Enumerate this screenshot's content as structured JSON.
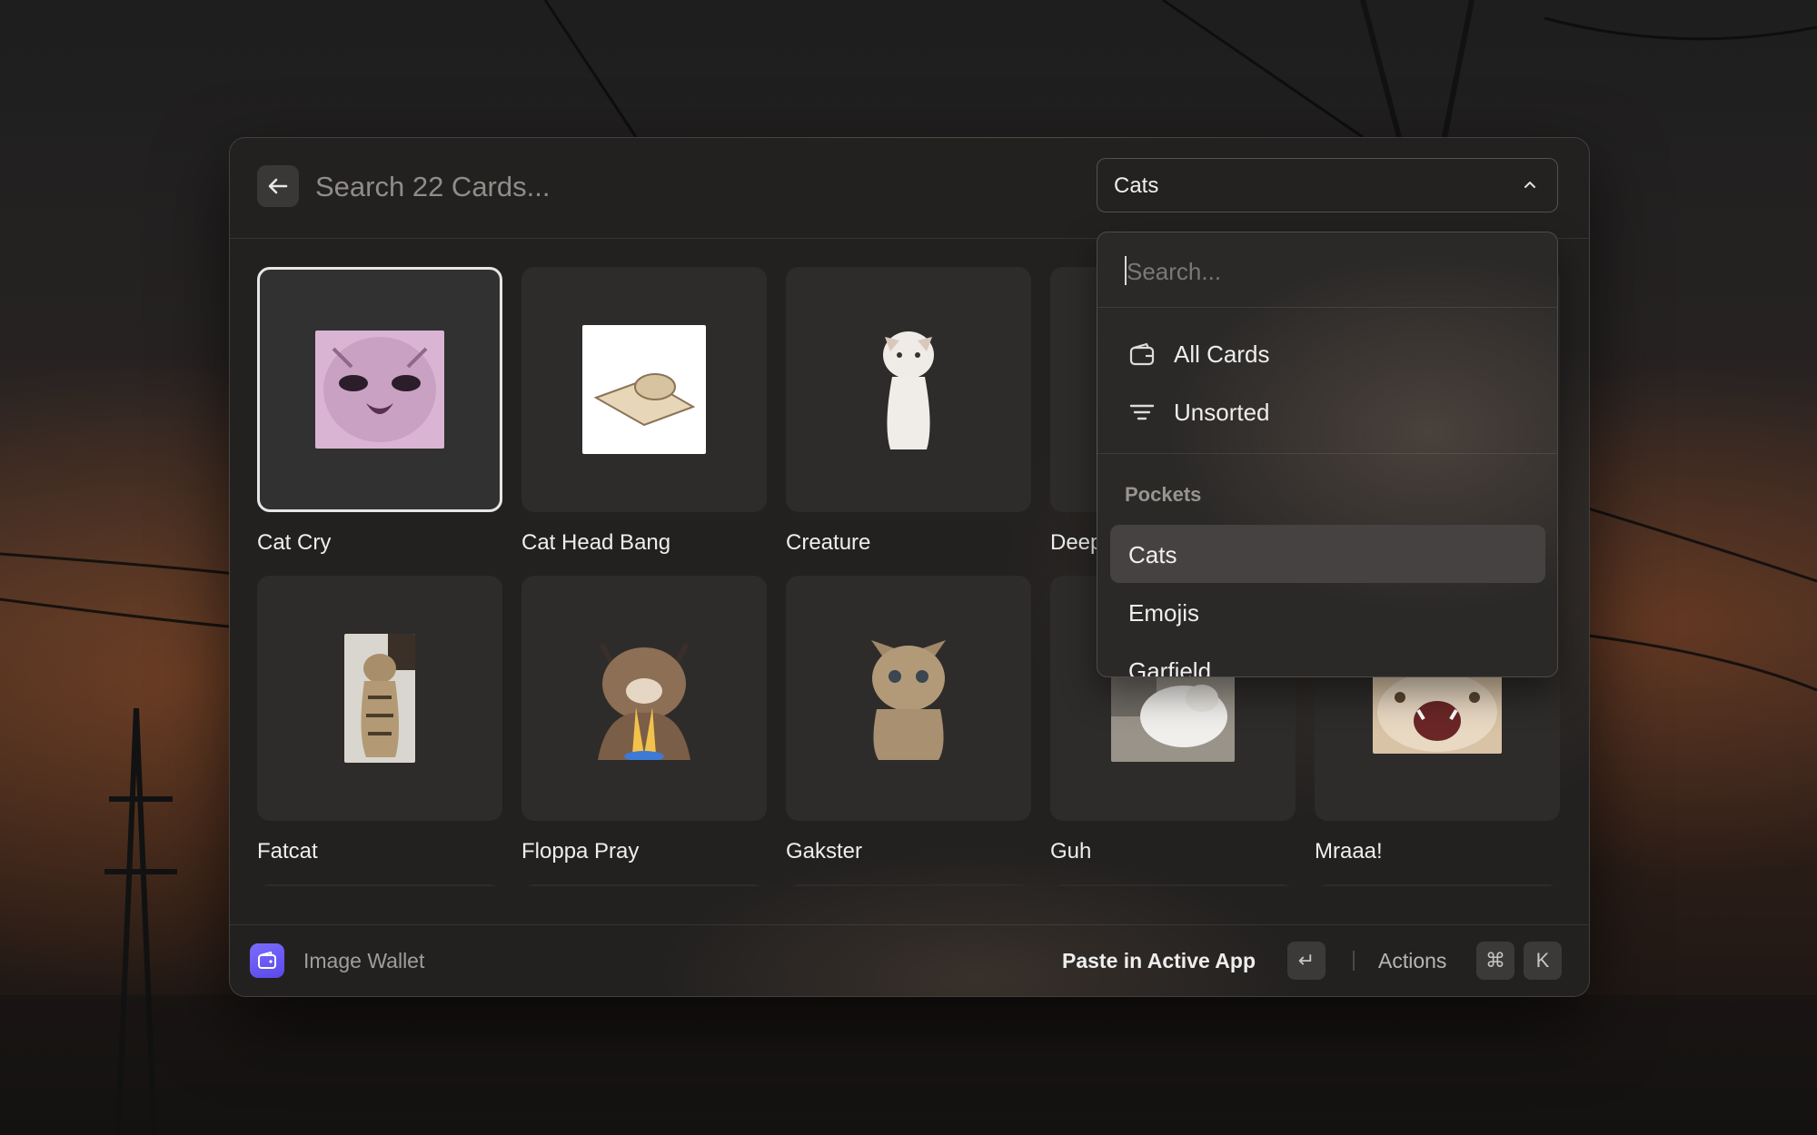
{
  "search": {
    "placeholder": "Search 22 Cards..."
  },
  "pocket_selector": {
    "selected": "Cats"
  },
  "dropdown": {
    "search_placeholder": "Search...",
    "items": [
      {
        "label": "All Cards",
        "icon": "wallet-icon"
      },
      {
        "label": "Unsorted",
        "icon": "filter-icon"
      }
    ],
    "section_title": "Pockets",
    "pockets": [
      {
        "label": "Cats",
        "active": true
      },
      {
        "label": "Emojis",
        "active": false
      },
      {
        "label": "Garfield",
        "active": false
      }
    ]
  },
  "cards": [
    {
      "label": "Cat Cry",
      "selected": true
    },
    {
      "label": "Cat Head Bang",
      "selected": false
    },
    {
      "label": "Creature",
      "selected": false
    },
    {
      "label": "Deep",
      "selected": false
    },
    {
      "label": "",
      "selected": false
    },
    {
      "label": "Fatcat",
      "selected": false
    },
    {
      "label": "Floppa Pray",
      "selected": false
    },
    {
      "label": "Gakster",
      "selected": false
    },
    {
      "label": "Guh",
      "selected": false
    },
    {
      "label": "Mraaa!",
      "selected": false
    }
  ],
  "footer": {
    "app_name": "Image Wallet",
    "primary_action": "Paste in Active App",
    "primary_key": "↵",
    "actions_label": "Actions",
    "actions_keys": [
      "⌘",
      "K"
    ]
  },
  "colors": {
    "accent": "#6b5cf6",
    "window_bg": "#232120"
  }
}
